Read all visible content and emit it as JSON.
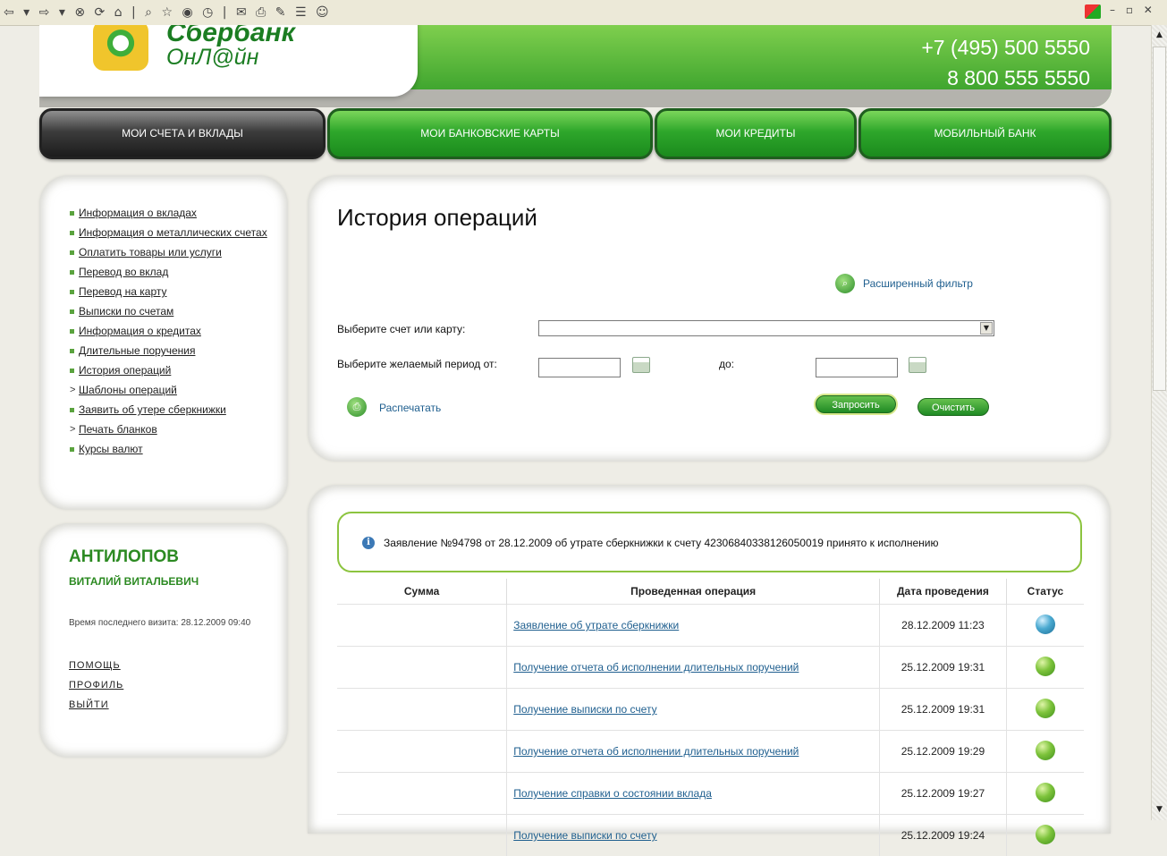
{
  "browser": {
    "toolbar_icons": [
      "back-icon",
      "forward-icon",
      "stop-icon",
      "refresh-icon",
      "home-icon",
      "search-icon",
      "favorites-icon",
      "media-icon",
      "history-icon",
      "mail-icon",
      "print-icon",
      "edit-icon",
      "discuss-icon",
      "messenger-icon"
    ],
    "window_controls": "– ▫ ✕"
  },
  "header": {
    "logo_line1": "Сбербанк",
    "logo_line2": "ОнЛ@йн",
    "phone1": "+7 (495) 500 5550",
    "phone2": "8 800 555 5550",
    "colors": {
      "brand_green": "#2e9a26",
      "accent_green": "#7fcf4e"
    }
  },
  "nav": {
    "tabs": [
      {
        "label": "МОИ СЧЕТА И ВКЛАДЫ",
        "active": true
      },
      {
        "label": "МОИ БАНКОВСКИЕ КАРТЫ",
        "active": false
      },
      {
        "label": "МОИ КРЕДИТЫ",
        "active": false
      },
      {
        "label": "МОБИЛЬНЫЙ БАНК",
        "active": false
      }
    ]
  },
  "sidebar": {
    "items": [
      {
        "label": "Информация о вкладах",
        "marker": "bullet"
      },
      {
        "label": "Информация о металлических счетах",
        "marker": "bullet"
      },
      {
        "label": "Оплатить товары или услуги",
        "marker": "bullet"
      },
      {
        "label": "Перевод во вклад",
        "marker": "bullet"
      },
      {
        "label": "Перевод на карту",
        "marker": "bullet"
      },
      {
        "label": "Выписки по счетам",
        "marker": "bullet"
      },
      {
        "label": "Информация о кредитах",
        "marker": "bullet"
      },
      {
        "label": "Длительные поручения",
        "marker": "bullet"
      },
      {
        "label": "История операций",
        "marker": "bullet"
      },
      {
        "label": "Шаблоны операций",
        "marker": "arrow"
      },
      {
        "label": "Заявить об утере сберкнижки",
        "marker": "bullet"
      },
      {
        "label": "Печать бланков",
        "marker": "arrow"
      },
      {
        "label": "Курсы валют",
        "marker": "bullet"
      }
    ],
    "arrow_glyph": ">"
  },
  "user": {
    "surname": "АНТИЛОПОВ",
    "name": "ВИТАЛИЙ ВИТАЛЬЕВИЧ",
    "last_visit": "Время последнего визита: 28.12.2009 09:40",
    "links": {
      "help": "ПОМОЩЬ",
      "profile": "ПРОФИЛЬ",
      "logout": "ВЫЙТИ"
    }
  },
  "main": {
    "title": "История операций",
    "extended_filter": "Расширенный фильтр",
    "select_label": "Выберите счет или карту:",
    "select_value": "",
    "period_label": "Выберите желаемый период от:",
    "to_label": "до:",
    "date_from": "",
    "date_to": "",
    "print_label": "Распечатать",
    "query_button": "Запросить",
    "clear_button": "Очистить"
  },
  "notice": {
    "icon_glyph": "i",
    "text": "Заявление №94798 от 28.12.2009 об утрате сберкнижки к счету 42306840338126050019 принято к исполнению"
  },
  "table": {
    "headers": {
      "amount": "Сумма",
      "operation": "Проведенная операция",
      "date": "Дата проведения",
      "status": "Статус"
    },
    "rows": [
      {
        "amount": "",
        "operation": "Заявление об утрате сберкнижки",
        "date": "28.12.2009 11:23",
        "status": "blue"
      },
      {
        "amount": "",
        "operation": "Получение отчета об исполнении длительных поручений",
        "date": "25.12.2009 19:31",
        "status": "green"
      },
      {
        "amount": "",
        "operation": "Получение выписки по счету",
        "date": "25.12.2009 19:31",
        "status": "green"
      },
      {
        "amount": "",
        "operation": "Получение отчета об исполнении длительных поручений",
        "date": "25.12.2009 19:29",
        "status": "green"
      },
      {
        "amount": "",
        "operation": "Получение справки о состоянии вклада",
        "date": "25.12.2009 19:27",
        "status": "green"
      },
      {
        "amount": "",
        "operation": "Получение выписки по счету",
        "date": "25.12.2009 19:24",
        "status": "green"
      }
    ]
  }
}
